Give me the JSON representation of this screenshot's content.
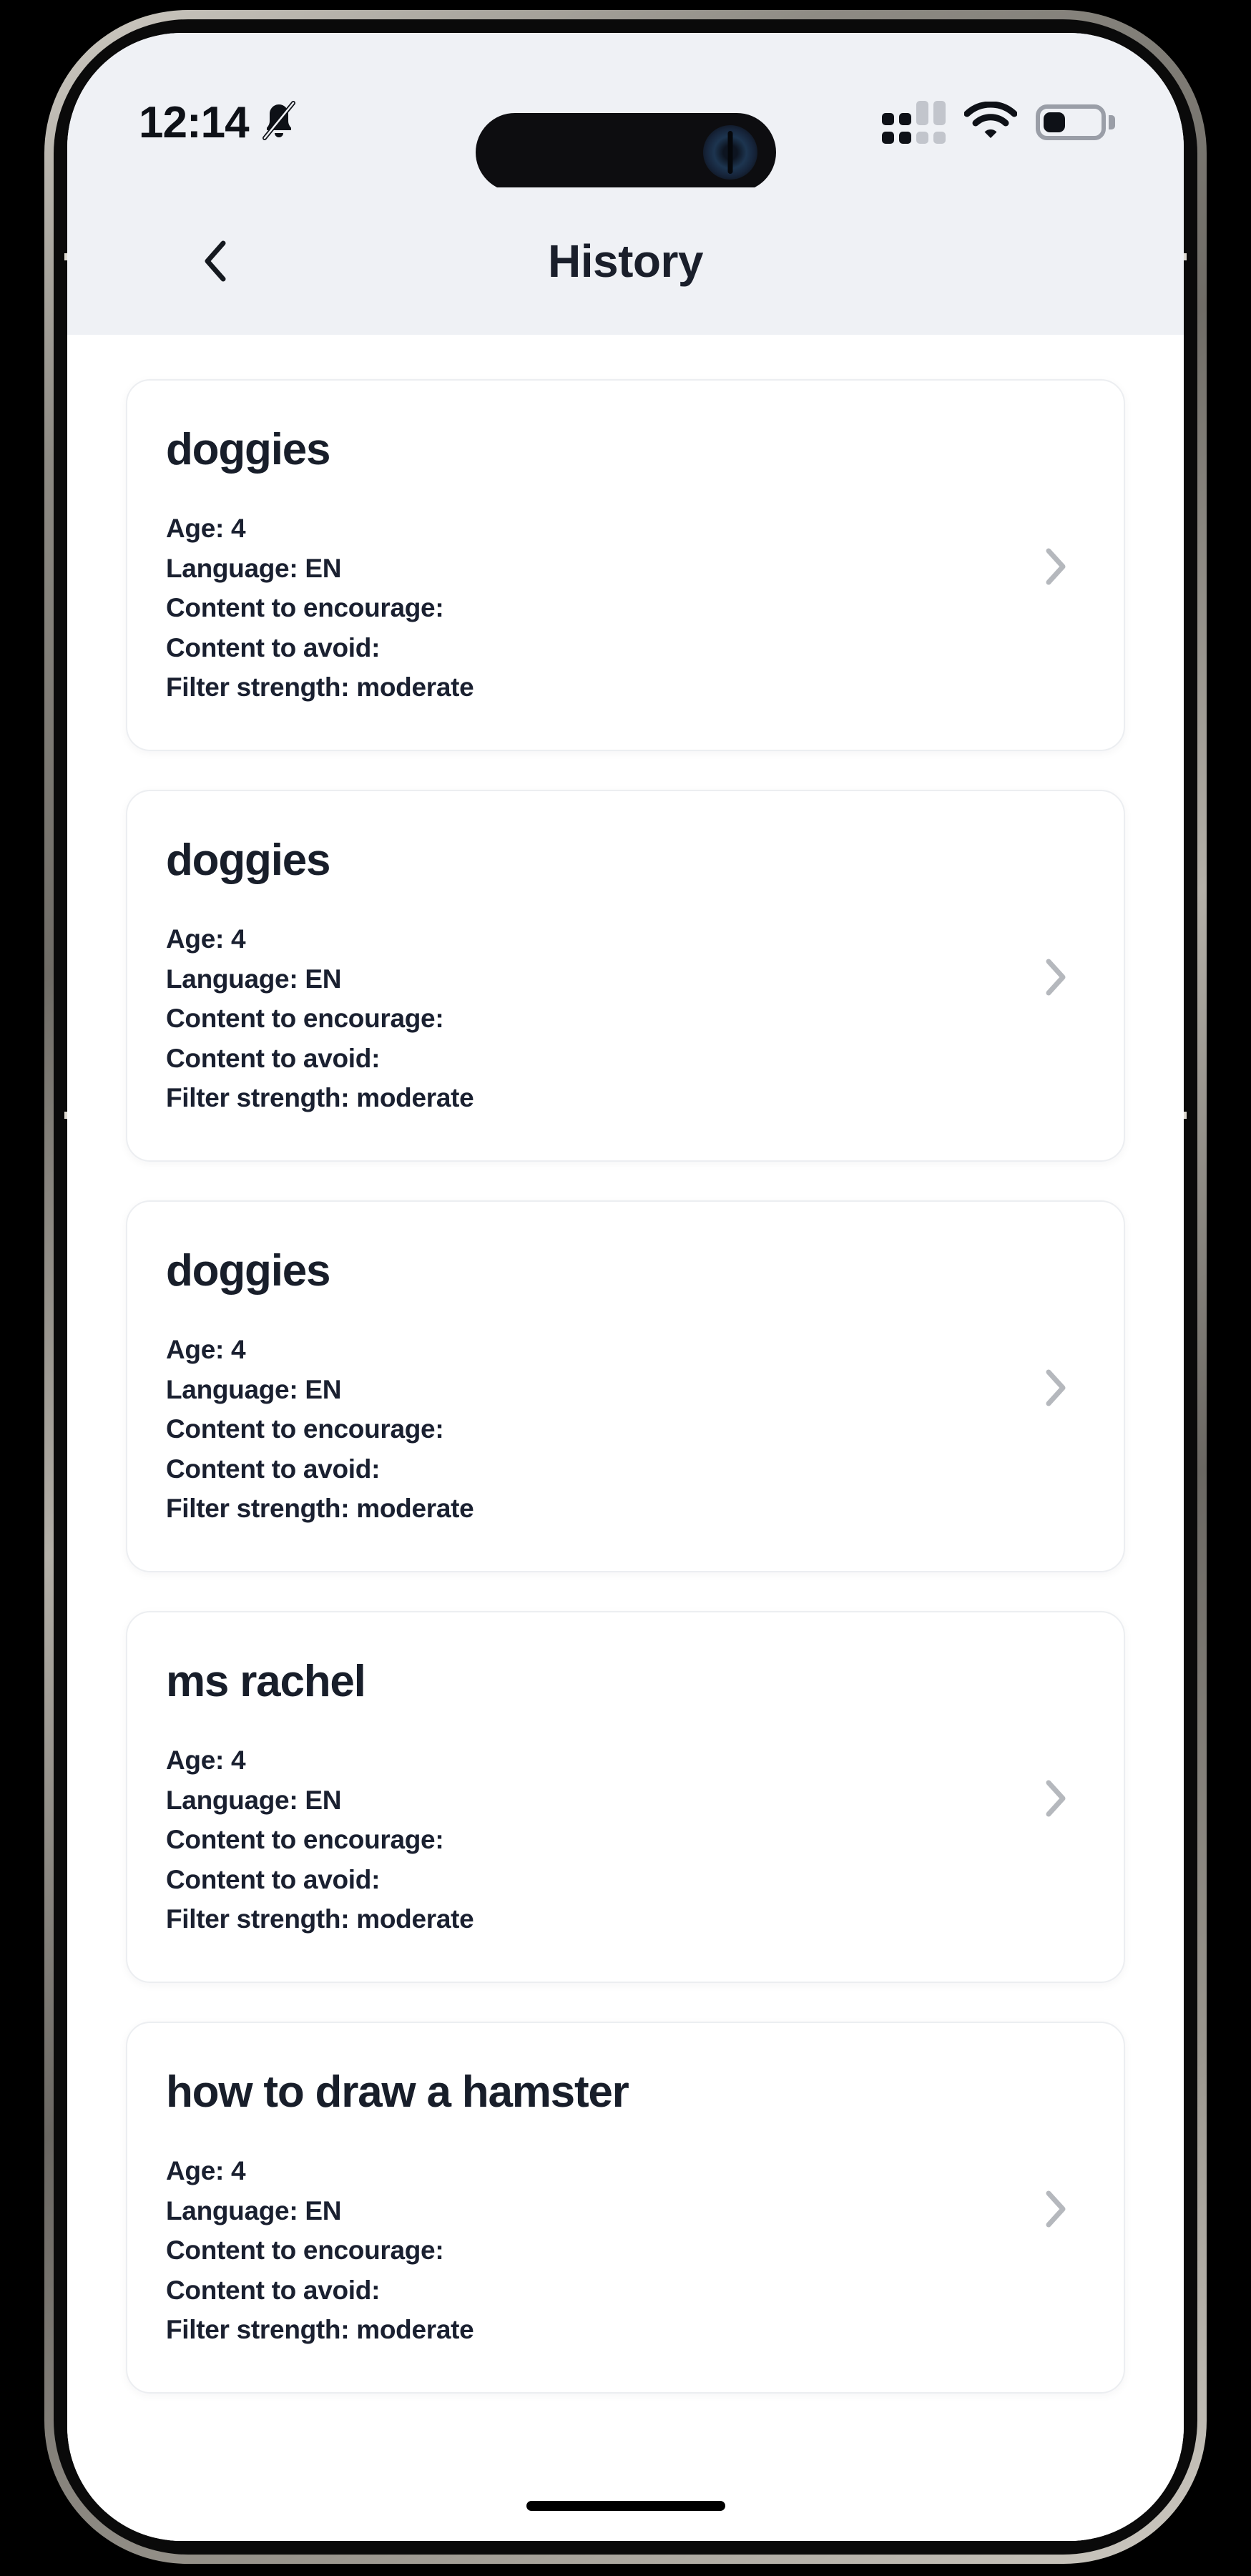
{
  "status_bar": {
    "time": "12:14",
    "silent_icon": "bell-slash-icon",
    "cellular_icon": "cellular-signal-icon",
    "wifi_icon": "wifi-icon",
    "battery_icon": "battery-icon",
    "battery_level_percent": 40
  },
  "header": {
    "back_icon": "chevron-left-icon",
    "title": "History"
  },
  "labels": {
    "age": "Age:",
    "language": "Language:",
    "content_to_encourage": "Content to encourage:",
    "content_to_avoid": "Content to avoid:",
    "filter_strength": "Filter strength:"
  },
  "colors": {
    "status_bar_bg": "#eff1f5",
    "page_bg": "#ffffff",
    "card_border": "#eceef1",
    "text_primary": "#181e2a",
    "chevron_gray": "#b5b8bd"
  },
  "history": {
    "items": [
      {
        "title": "doggies",
        "age": "Age: 4",
        "language": "Language: EN",
        "encourage": "Content to encourage:",
        "avoid": "Content to avoid:",
        "filter": "Filter strength: moderate",
        "chevron": "chevron-right-icon"
      },
      {
        "title": "doggies",
        "age": "Age: 4",
        "language": "Language: EN",
        "encourage": "Content to encourage:",
        "avoid": "Content to avoid:",
        "filter": "Filter strength: moderate",
        "chevron": "chevron-right-icon"
      },
      {
        "title": "doggies",
        "age": "Age: 4",
        "language": "Language: EN",
        "encourage": "Content to encourage:",
        "avoid": "Content to avoid:",
        "filter": "Filter strength: moderate",
        "chevron": "chevron-right-icon"
      },
      {
        "title": "ms rachel",
        "age": "Age: 4",
        "language": "Language: EN",
        "encourage": "Content to encourage:",
        "avoid": "Content to avoid:",
        "filter": "Filter strength: moderate",
        "chevron": "chevron-right-icon"
      },
      {
        "title": "how to draw a hamster",
        "age": "Age: 4",
        "language": "Language: EN",
        "encourage": "Content to encourage:",
        "avoid": "Content to avoid:",
        "filter": "Filter strength: moderate",
        "chevron": "chevron-right-icon"
      }
    ]
  }
}
